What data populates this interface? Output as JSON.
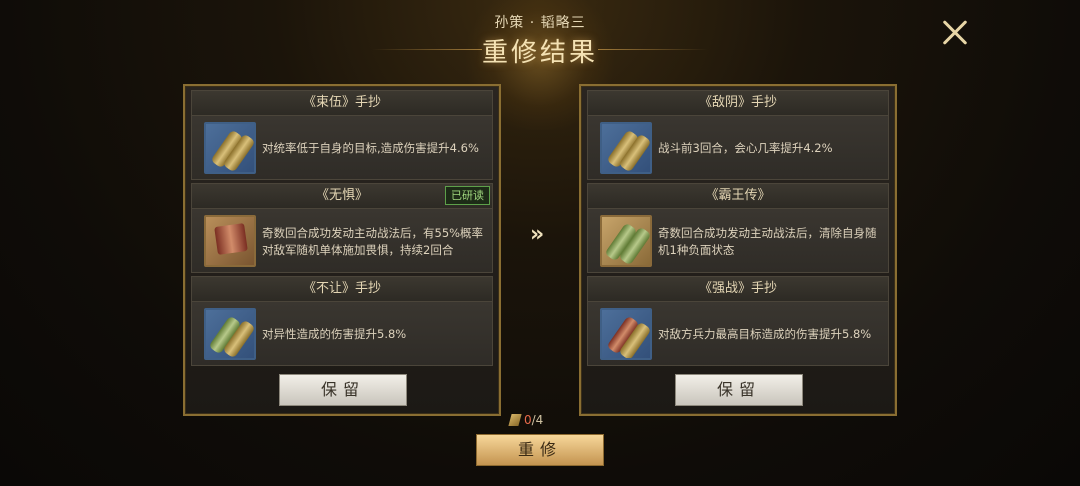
{
  "header": {
    "subtitle": "孙策 · 韬略三",
    "title": "重修结果",
    "close_icon": "close-icon"
  },
  "left_panel": {
    "slots": [
      {
        "name": "《束伍》手抄",
        "desc": "对统率低于自身的目标,造成伤害提升4.6%",
        "icon": "blue-scroll-icon"
      },
      {
        "name": "《无惧》",
        "desc": "奇数回合成功发动主动战法后，有55%概率对敌军随机单体施加畏惧，持续2回合",
        "icon": "red-book-icon",
        "badge": "已研读"
      },
      {
        "name": "《不让》手抄",
        "desc": "对异性造成的伤害提升5.8%",
        "icon": "blue-scroll-icon"
      }
    ],
    "keep_label": "保留"
  },
  "right_panel": {
    "slots": [
      {
        "name": "《敌阴》手抄",
        "desc": "战斗前3回合，会心几率提升4.2%",
        "icon": "blue-scroll-icon"
      },
      {
        "name": "《霸王传》",
        "desc": "奇数回合成功发动主动战法后，清除自身随机1种负面状态",
        "icon": "green-scroll-icon"
      },
      {
        "name": "《强战》手抄",
        "desc": "对敌方兵力最高目标造成的伤害提升5.8%",
        "icon": "blue-scroll-icon"
      }
    ],
    "keep_label": "保留"
  },
  "arrow": "»",
  "counter": {
    "used": "0",
    "total": "/4"
  },
  "reroll_label": "重修"
}
